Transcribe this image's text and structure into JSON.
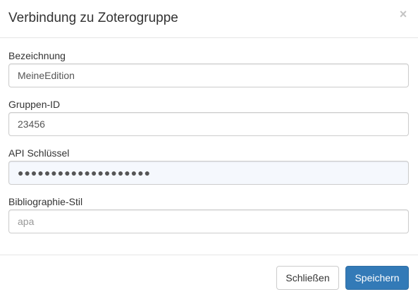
{
  "dialog": {
    "title": "Verbindung zu Zoterogruppe",
    "close_symbol": "×"
  },
  "form": {
    "fields": [
      {
        "label": "Bezeichnung",
        "value": "MeineEdition",
        "placeholder": ""
      },
      {
        "label": "Gruppen-ID",
        "value": "23456",
        "placeholder": ""
      },
      {
        "label": "API Schlüssel",
        "value": "●●●●●●●●●●●●●●●●●●●●",
        "placeholder": ""
      },
      {
        "label": "Bibliographie-Stil",
        "value": "",
        "placeholder": "apa"
      }
    ]
  },
  "footer": {
    "close_label": "Schließen",
    "save_label": "Speichern"
  },
  "colors": {
    "primary": "#337ab7",
    "border": "#cccccc",
    "divider": "#e5e5e5"
  }
}
